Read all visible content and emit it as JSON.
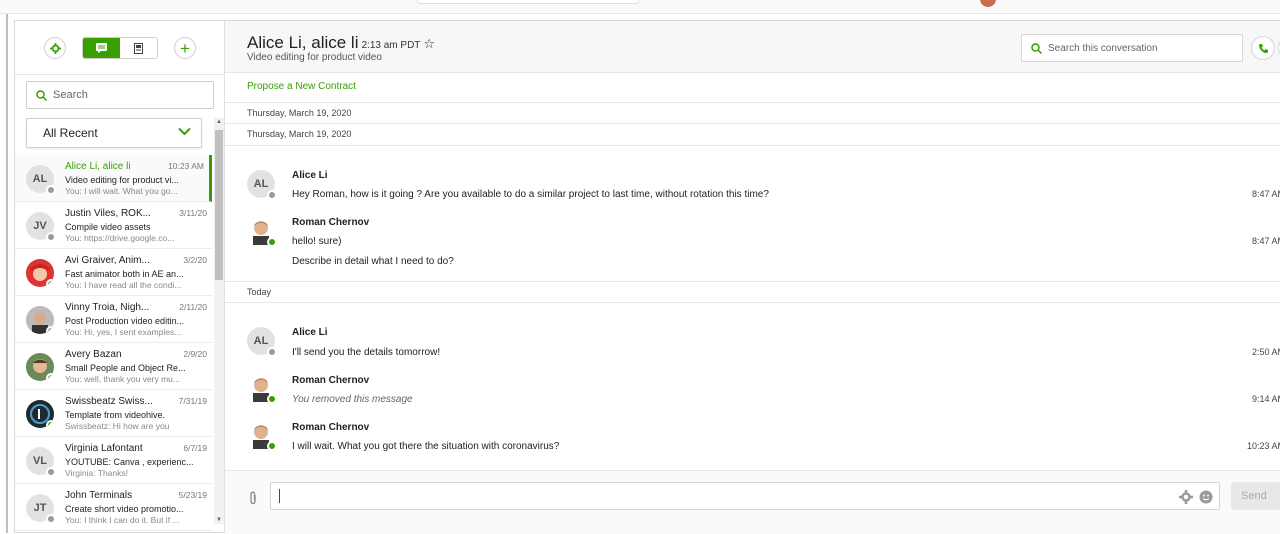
{
  "sidebar": {
    "search_placeholder": "Search",
    "filter_selected": "All Recent",
    "conversations": [
      {
        "initials": "AL",
        "name": "Alice Li, alice li",
        "date": "10:23 AM",
        "subject": "Video editing for product vi...",
        "preview": "You: I will wait. What you go...",
        "status": "offline",
        "active": true
      },
      {
        "initials": "JV",
        "name": "Justin Viles, ROK...",
        "date": "3/11/20",
        "subject": "Compile video assets",
        "preview": "You: https://drive.google.co...",
        "status": "offline"
      },
      {
        "initials": "",
        "name": "Avi Graiver, Anim...",
        "date": "3/2/20",
        "subject": "Fast animator both in AE an...",
        "preview": "You: I have read all the condi...",
        "status": "offline"
      },
      {
        "initials": "",
        "name": "Vinny Troia, Nigh...",
        "date": "2/11/20",
        "subject": "Post Production video editin...",
        "preview": "You: Hi, yes, I sent examples...",
        "status": "offline"
      },
      {
        "initials": "",
        "name": "Avery Bazan",
        "date": "2/9/20",
        "subject": "Small People and Object Re...",
        "preview": "You: well, thank you very mu...",
        "status": "offline"
      },
      {
        "initials": "",
        "name": "Swissbeatz Swiss...",
        "date": "7/31/19",
        "subject": "Template from videohive.",
        "preview": "Swissbeatz: Hi how are you",
        "status": "online"
      },
      {
        "initials": "VL",
        "name": "Virginia Lafontant",
        "date": "6/7/19",
        "subject": "YOUTUBE: Canva , experienc...",
        "preview": "Virginia: Thanks!",
        "status": "offline"
      },
      {
        "initials": "JT",
        "name": "John Terminals",
        "date": "5/23/19",
        "subject": "Create short video promotio...",
        "preview": "You: I think I can do it. But if ...",
        "status": "offline"
      }
    ]
  },
  "header": {
    "title": "Alice Li, alice li",
    "time": "2:13 am PDT",
    "subtitle": "Video editing for product video",
    "search_placeholder": "Search this conversation"
  },
  "propose_link": "Propose a New Contract",
  "date_dividers": [
    "Thursday, March 19, 2020",
    "Thursday, March 19, 2020",
    "Today"
  ],
  "messages": [
    {
      "author": "Alice Li",
      "initials": "AL",
      "lines": [
        "Hey Roman, how is it going ? Are you available to do a similar project to last time, without rotation this time?"
      ],
      "time": "8:47 AM",
      "status": "offline"
    },
    {
      "author": "Roman Chernov",
      "lines": [
        "hello! sure)",
        "Describe in detail what I need to do?"
      ],
      "time": "8:47 AM",
      "status": "online"
    },
    {
      "author": "Alice Li",
      "initials": "AL",
      "lines": [
        "I'll send you the details tomorrow!"
      ],
      "time": "2:50 AM",
      "status": "offline"
    },
    {
      "author": "Roman Chernov",
      "lines": [
        "You removed this message"
      ],
      "time": "9:14 AM",
      "status": "online",
      "removed": true
    },
    {
      "author": "Roman Chernov",
      "lines": [
        "I will wait. What you got there the situation with coronavirus?"
      ],
      "time": "10:23 AM",
      "status": "online"
    }
  ],
  "composer": {
    "send_label": "Send"
  },
  "colors": {
    "accent": "#37a000",
    "offline": "#9b9b9b"
  },
  "icons": [
    "gear-icon",
    "chat-icon",
    "contacts-icon",
    "plus-icon",
    "search-icon",
    "chevron-down-icon",
    "star-icon",
    "phone-icon",
    "paperclip-icon",
    "emoji-icon"
  ]
}
